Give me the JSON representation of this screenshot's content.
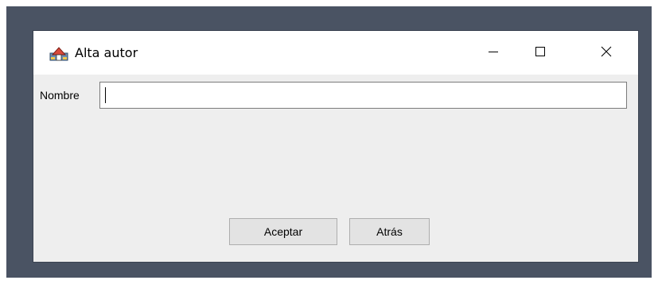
{
  "window": {
    "title": "Alta autor",
    "icons": {
      "app": "app-icon",
      "minimize": "minimize-icon",
      "maximize": "maximize-icon",
      "close": "close-icon"
    }
  },
  "form": {
    "nombre_label": "Nombre",
    "nombre_value": ""
  },
  "buttons": {
    "aceptar": "Aceptar",
    "atras": "Atrás"
  },
  "colors": {
    "backdrop": "#4a5363",
    "titlebar": "#ffffff",
    "client": "#eeeeee",
    "button_face": "#e3e3e3",
    "button_border": "#adadad"
  }
}
